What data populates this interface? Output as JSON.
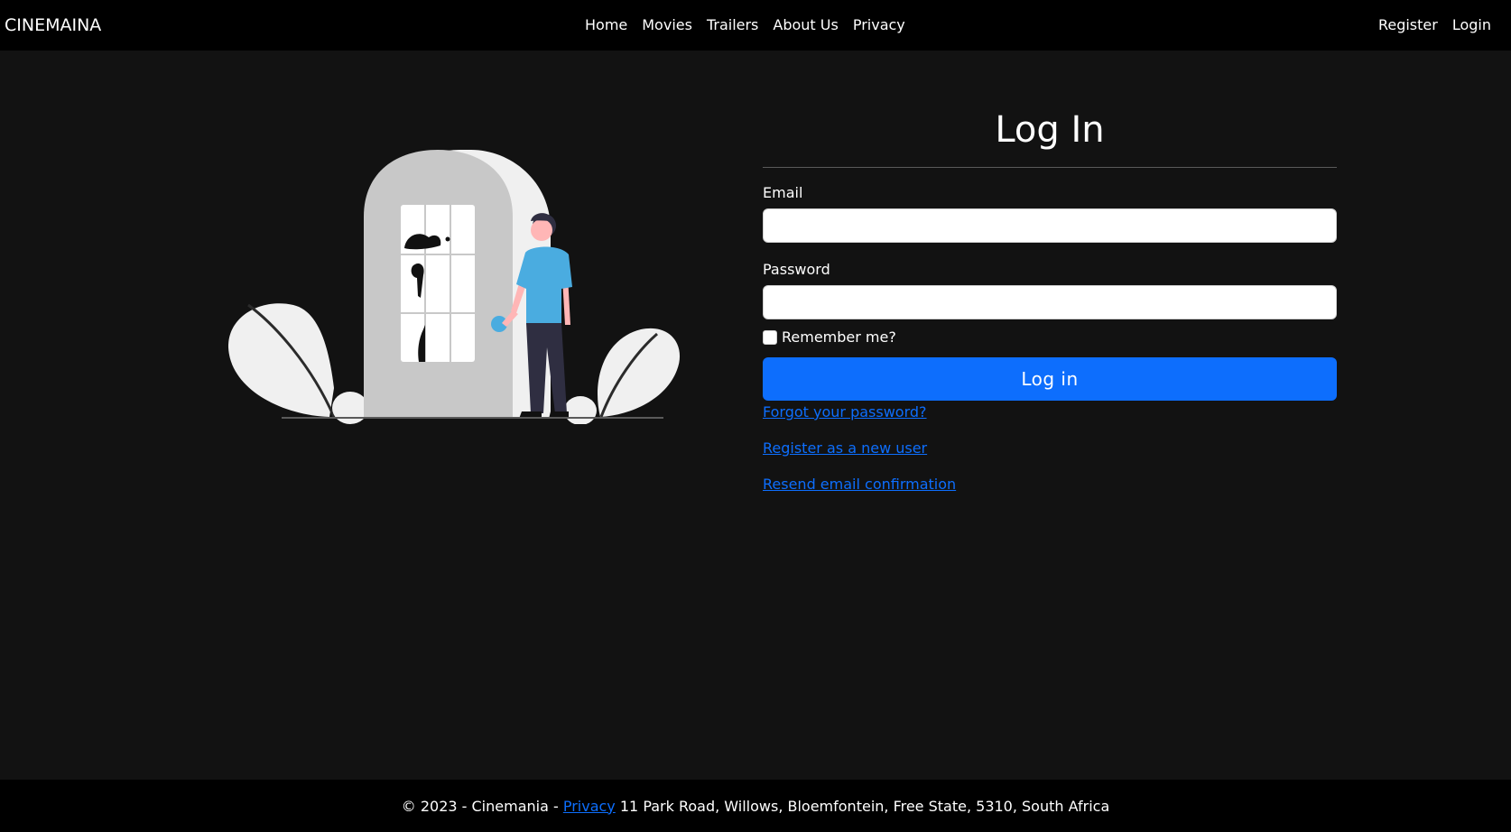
{
  "navbar": {
    "brand": "CINEMAINA",
    "links": [
      "Home",
      "Movies",
      "Trailers",
      "About Us",
      "Privacy"
    ],
    "auth_links": [
      "Register",
      "Login"
    ]
  },
  "login": {
    "title": "Log In",
    "email_label": "Email",
    "email_value": "",
    "password_label": "Password",
    "password_value": "",
    "remember_label": "Remember me?",
    "remember_checked": false,
    "submit_label": "Log in",
    "links": [
      "Forgot your password?",
      "Register as a new user",
      "Resend email confirmation"
    ]
  },
  "footer": {
    "prefix": "© 2023 - Cinemania -",
    "privacy_link": "Privacy",
    "address": "11 Park Road, Willows, Bloemfontein, Free State, 5310, South Africa"
  },
  "colors": {
    "background": "#121212",
    "navbar": "#000000",
    "primary": "#0d6efd",
    "text": "#ffffff"
  },
  "illustration": {
    "icon": "person-at-door-illustration"
  }
}
